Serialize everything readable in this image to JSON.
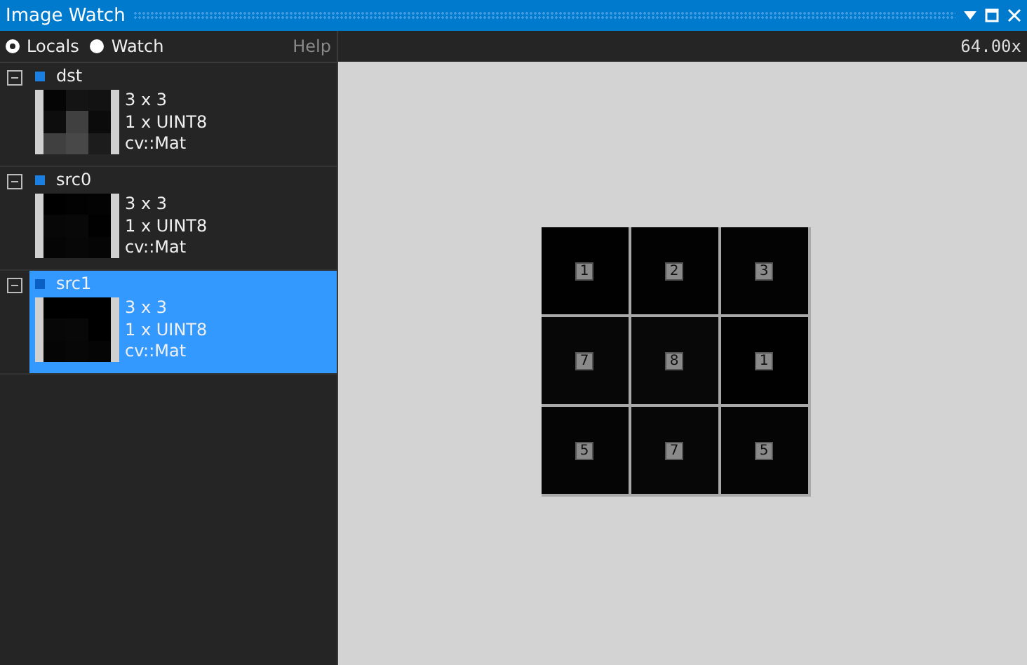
{
  "window": {
    "title": "Image Watch"
  },
  "modes": [
    {
      "label": "Locals",
      "selected": true
    },
    {
      "label": "Watch",
      "selected": false
    }
  ],
  "help": "Help",
  "zoom": "64.00x",
  "items": [
    {
      "name": "dst",
      "expanded": true,
      "selected": false,
      "size": "3 x 3",
      "format": "1 x UINT8",
      "type": "cv::Mat"
    },
    {
      "name": "src0",
      "expanded": true,
      "selected": false,
      "size": "3 x 3",
      "format": "1 x UINT8",
      "type": "cv::Mat"
    },
    {
      "name": "src1",
      "expanded": true,
      "selected": true,
      "size": "3 x 3",
      "format": "1 x UINT8",
      "type": "cv::Mat"
    }
  ],
  "pixels": [
    {
      "value": "1",
      "color": "#010101"
    },
    {
      "value": "2",
      "color": "#020202"
    },
    {
      "value": "3",
      "color": "#030303"
    },
    {
      "value": "7",
      "color": "#070707"
    },
    {
      "value": "8",
      "color": "#080808"
    },
    {
      "value": "1",
      "color": "#010101"
    },
    {
      "value": "5",
      "color": "#050505"
    },
    {
      "value": "7",
      "color": "#070707"
    },
    {
      "value": "5",
      "color": "#050505"
    }
  ]
}
